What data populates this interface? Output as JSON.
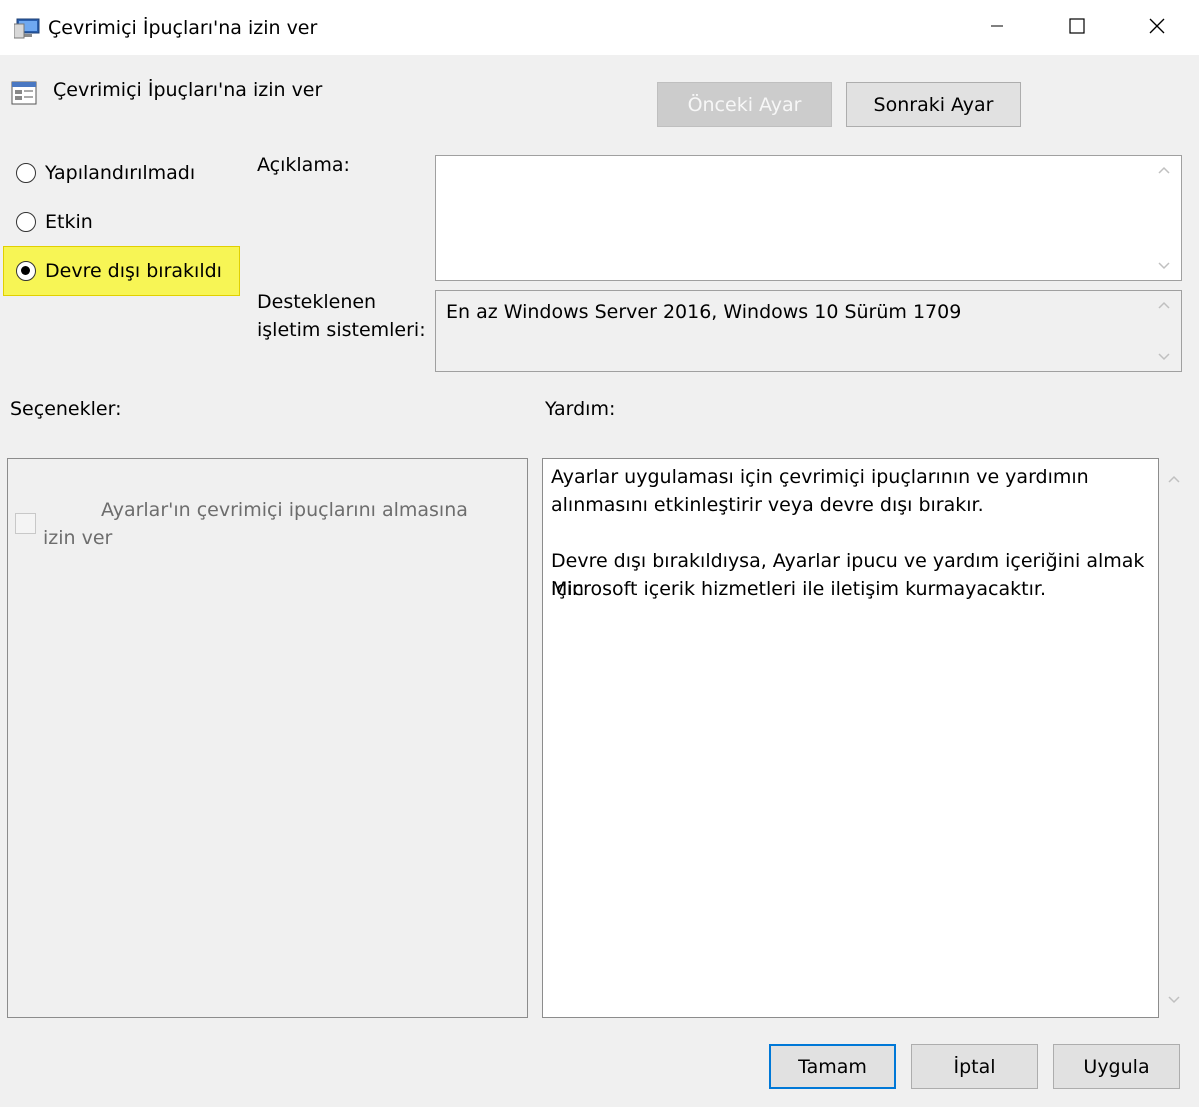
{
  "window": {
    "title": "Çevrimiçi İpuçları'na izin ver",
    "minimize": "minimize",
    "maximize": "maximize",
    "close": "close"
  },
  "header": {
    "policy_name": "Çevrimiçi İpuçları'na izin ver",
    "prev_setting": "Önceki Ayar",
    "next_setting": "Sonraki Ayar"
  },
  "state": {
    "not_configured": "Yapılandırılmadı",
    "enabled": "Etkin",
    "disabled": "Devre dışı bırakıldı",
    "selected": "disabled"
  },
  "comment": {
    "label": "Açıklama:",
    "value": ""
  },
  "supported": {
    "label_line1": "Desteklenen",
    "label_line2": "işletim sistemleri:",
    "value": "En az Windows Server 2016, Windows 10 Sürüm 1709"
  },
  "options": {
    "label": "Seçenekler:",
    "checkbox_label_line1": "Ayarlar'ın çevrimiçi ipuçlarını almasına",
    "checkbox_label_line2": "izin ver",
    "checked": false
  },
  "help": {
    "label": "Yardım:",
    "paragraph1_line1": "Ayarlar uygulaması için çevrimiçi ipuçlarının ve yardımın",
    "paragraph1_line2": "alınmasını etkinleştirir veya devre dışı bırakır.",
    "paragraph2_line1": "Devre dışı bırakıldıysa, Ayarlar ipucu ve yardım içeriğini almak için",
    "paragraph2_line2": "Microsoft içerik hizmetleri ile iletişim kurmayacaktır."
  },
  "footer": {
    "ok": "Tamam",
    "cancel": "İptal",
    "apply": "Uygula"
  },
  "colors": {
    "highlight": "#f7f555",
    "accent": "#0078d7"
  }
}
